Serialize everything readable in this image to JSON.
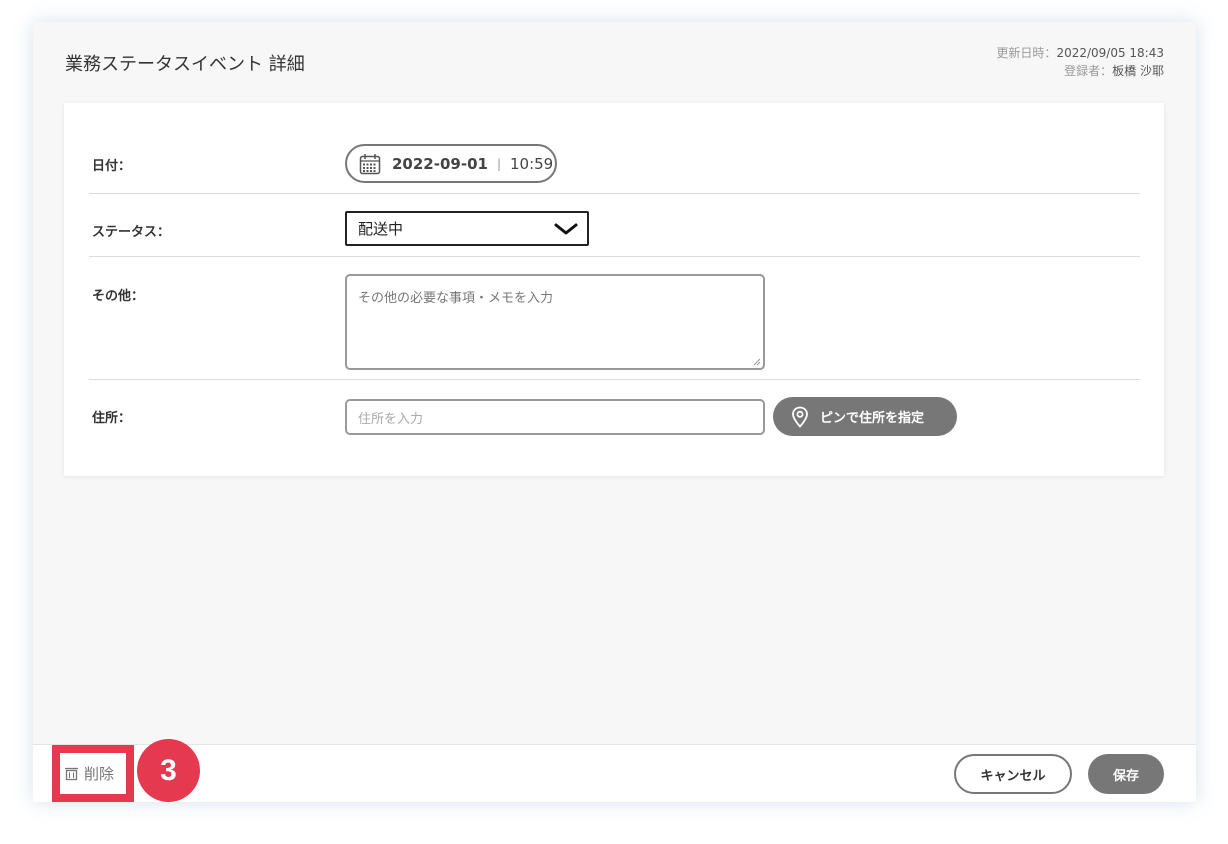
{
  "header": {
    "title": "業務ステータスイベント 詳細",
    "updated_label": "更新日時：",
    "updated_value": "2022/09/05 18:43",
    "registrant_label": "登録者：",
    "registrant_value": "板橋 沙耶"
  },
  "form": {
    "date": {
      "label": "日付：",
      "date_value": "2022-09-01",
      "separator": "|",
      "time_value": "10:59"
    },
    "status": {
      "label": "ステータス：",
      "selected": "配送中"
    },
    "other": {
      "label": "その他：",
      "placeholder": "その他の必要な事項・メモを入力"
    },
    "address": {
      "label": "住所：",
      "placeholder": "住所を入力",
      "pin_button_label": "ピンで住所を指定"
    }
  },
  "footer": {
    "delete_label": "削除",
    "step_badge": "3",
    "cancel_label": "キャンセル",
    "save_label": "保存"
  },
  "colors": {
    "accent_highlight": "#e5394f",
    "button_gray": "#777777",
    "panel_bg": "#f7f7f7"
  },
  "icons": [
    "calendar-icon",
    "chevron-down-icon",
    "map-pin-icon",
    "trash-icon"
  ]
}
